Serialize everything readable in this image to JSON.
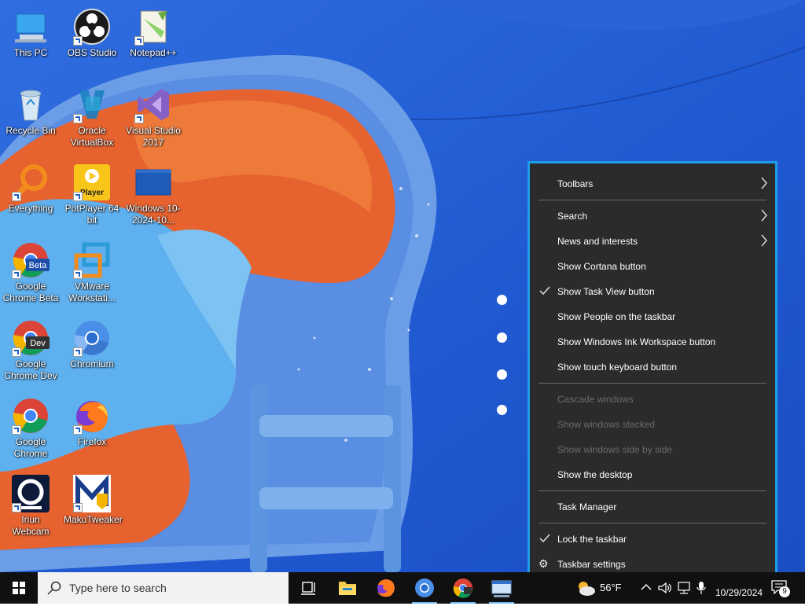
{
  "desktop": {
    "icons": [
      {
        "label": "This PC",
        "icon": "computer-icon"
      },
      {
        "label": "OBS Studio",
        "icon": "obs-icon"
      },
      {
        "label": "Notepad++",
        "icon": "notepad-plus-plus-icon"
      },
      {
        "label": "Recycle Bin",
        "icon": "recycle-bin-icon"
      },
      {
        "label": "Oracle VirtualBox",
        "icon": "virtualbox-icon"
      },
      {
        "label": "Visual Studio 2017",
        "icon": "visual-studio-icon"
      },
      {
        "label": "Everything",
        "icon": "everything-search-icon"
      },
      {
        "label": "PotPlayer 64 bit",
        "icon": "potplayer-icon",
        "badge": "Player"
      },
      {
        "label": "Windows 10-2024-10...",
        "icon": "vm-window-icon"
      },
      {
        "label": "Google Chrome Beta",
        "icon": "chrome-beta-icon",
        "badge": "Beta"
      },
      {
        "label": "VMware Workstati...",
        "icon": "vmware-icon"
      },
      {
        "label": "Google Chrome Dev",
        "icon": "chrome-dev-icon",
        "badge": "Dev"
      },
      {
        "label": "Chromium",
        "icon": "chromium-icon"
      },
      {
        "label": "Google Chrome",
        "icon": "chrome-icon"
      },
      {
        "label": "Firefox",
        "icon": "firefox-icon"
      },
      {
        "label": "Iriun Webcam",
        "icon": "webcam-icon"
      },
      {
        "label": "MakuTweaker",
        "icon": "makutweaker-icon"
      }
    ]
  },
  "context_menu": {
    "items": [
      {
        "label": "Toolbars",
        "submenu": true
      },
      {
        "label": "Search",
        "submenu": true
      },
      {
        "label": "News and interests",
        "submenu": true
      },
      {
        "label": "Show Cortana button"
      },
      {
        "label": "Show Task View button",
        "checked": true
      },
      {
        "label": "Show People on the taskbar"
      },
      {
        "label": "Show Windows Ink Workspace button"
      },
      {
        "label": "Show touch keyboard button"
      },
      {
        "label": "Cascade windows",
        "disabled": true
      },
      {
        "label": "Show windows stacked",
        "disabled": true
      },
      {
        "label": "Show windows side by side",
        "disabled": true
      },
      {
        "label": "Show the desktop"
      },
      {
        "label": "Task Manager"
      },
      {
        "label": "Lock the taskbar",
        "checked": true
      },
      {
        "label": "Taskbar settings",
        "icon": "gear-icon"
      }
    ]
  },
  "taskbar": {
    "search_placeholder": "Type here to search",
    "weather": "56°F",
    "date": "10/29/2024",
    "notification_count": "9",
    "apps": [
      "task-view-icon",
      "file-explorer-icon",
      "firefox-icon",
      "chromium-icon",
      "chrome-dev-icon",
      "network-window-icon"
    ]
  },
  "colors": {
    "menu_bg": "#2b2b2b",
    "menu_border": "#1e9ee8",
    "taskbar_bg": "#101010",
    "wallpaper_blue": "#1f5bd6"
  }
}
